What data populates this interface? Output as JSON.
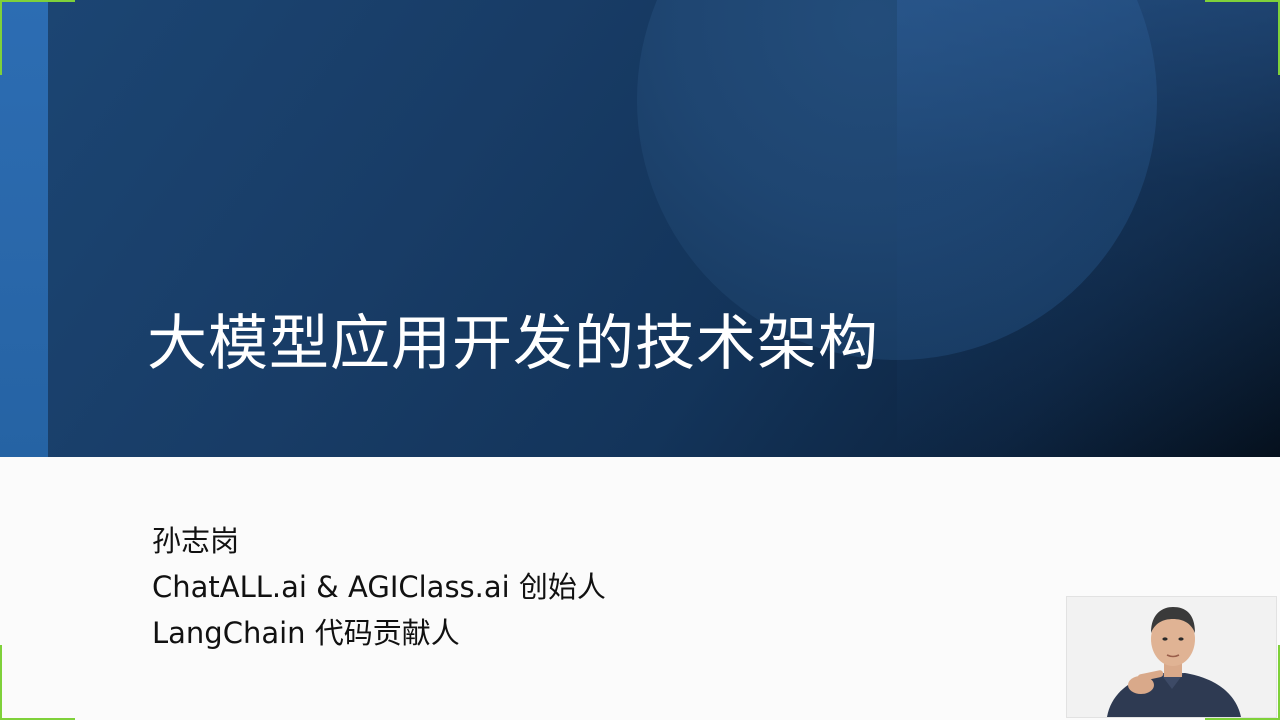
{
  "slide": {
    "title": "大模型应用开发的技术架构",
    "presenter_name": "孙志岗",
    "presenter_role_1": "ChatALL.ai & AGIClass.ai 创始人",
    "presenter_role_2": "LangChain 代码贡献人"
  },
  "webcam": {
    "subject": "presenter-video"
  },
  "colors": {
    "banner_dark": "#0d2440",
    "banner_blue": "#1c4674",
    "left_strip": "#2c6db3",
    "title_text": "#ffffff",
    "body_text": "#111111",
    "corner_marks": "#7fd13a"
  }
}
